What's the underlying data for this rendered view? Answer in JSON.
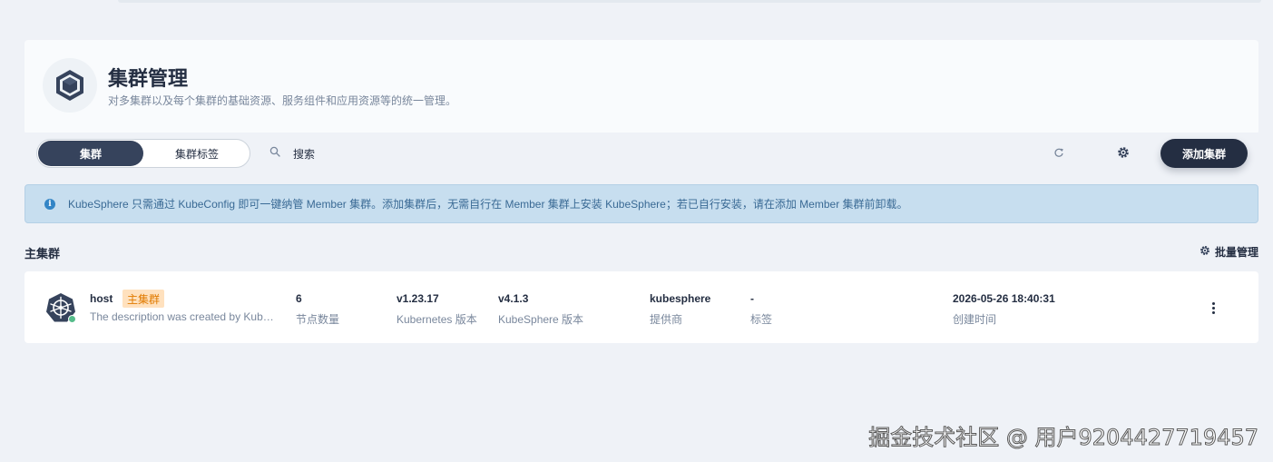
{
  "header": {
    "title": "集群管理",
    "description": "对多集群以及每个集群的基础资源、服务组件和应用资源等的统一管理。"
  },
  "toolbar": {
    "tabs": [
      {
        "label": "集群",
        "active": true
      },
      {
        "label": "集群标签",
        "active": false
      }
    ],
    "search_placeholder": "搜索",
    "add_label": "添加集群"
  },
  "notice": {
    "text": "KubeSphere 只需通过 KubeConfig 即可一键纳管 Member 集群。添加集群后，无需自行在 Member 集群上安装 KubeSphere；若已自行安装，请在添加 Member 集群前卸载。"
  },
  "section": {
    "title": "主集群",
    "batch_label": "批量管理"
  },
  "clusters": [
    {
      "name": "host",
      "tag": "主集群",
      "description": "The description was created by KubeSphere",
      "status_color": "#55bc8a",
      "nodes": {
        "value": "6",
        "label": "节点数量"
      },
      "k8s": {
        "value": "v1.23.17",
        "label": "Kubernetes 版本"
      },
      "ks": {
        "value": "v4.1.3",
        "label": "KubeSphere 版本"
      },
      "provider": {
        "value": "kubesphere",
        "label": "提供商"
      },
      "labels": {
        "value": "-",
        "label": "标签"
      },
      "created": {
        "value": "2026-05-26 18:40:31",
        "label": "创建时间"
      }
    }
  ],
  "watermark": "掘金技术社区 @ 用户9204427719457",
  "colors": {
    "primary_dark": "#242e42",
    "accent_tab": "#36435c",
    "notice_bg": "#c7deef",
    "tag_bg": "#ffe1be",
    "tag_text": "#e07a00",
    "status_ok": "#55bc8a"
  },
  "icons": {
    "banner": "cluster-cube-icon",
    "search": "search-icon",
    "refresh": "refresh-icon",
    "settings": "gear-icon",
    "info": "info-icon",
    "batch": "gear-icon",
    "cluster": "kubernetes-helm-icon",
    "more": "more-vertical-icon"
  }
}
